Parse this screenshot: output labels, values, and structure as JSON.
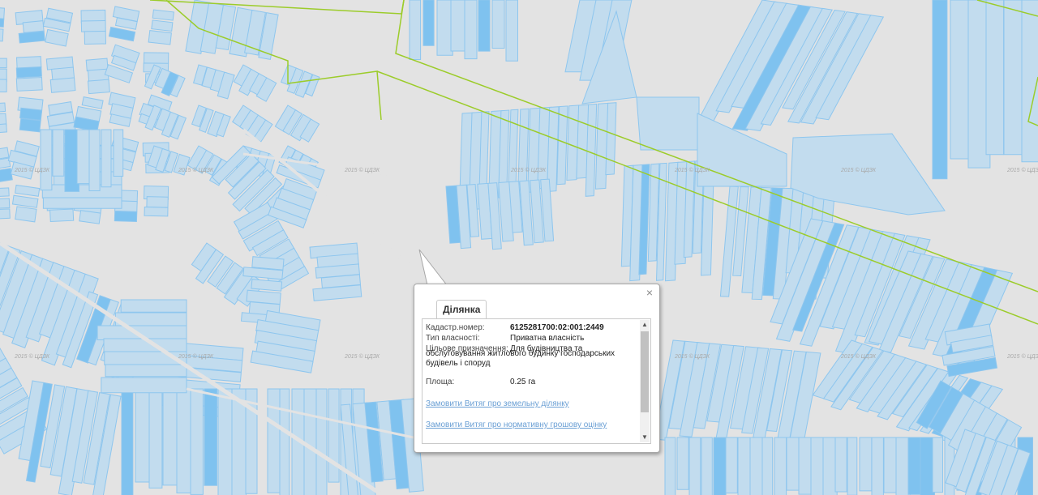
{
  "map": {
    "watermark_text": "2015 © ЦДЗК",
    "colors": {
      "background": "#e3e3e3",
      "parcel_fill": "#c2dcee",
      "parcel_stroke": "#8ec6ee",
      "boundary": "#9ccc2a",
      "highlight": "#7fc2ef"
    }
  },
  "popup": {
    "tab_label": "Ділянка",
    "close_glyph": "×",
    "fields": {
      "cadastral_label": "Кадастр.номер:",
      "cadastral_value": "6125281700:02:001:2449",
      "ownership_label": "Тип власності:",
      "ownership_value": "Приватна власність",
      "purpose_label": "Цільове призначення:",
      "purpose_value_line1": "Для будівництва та",
      "purpose_value_rest": "обслуговування житлового будинку господарських будівель і споруд",
      "area_label": "Площа:",
      "area_value": "0.25 га"
    },
    "links": {
      "land_extract": "Замовити Витяг про земельну ділянку",
      "valuation_extract": "Замовити Витяг про нормативну грошову оцінку"
    },
    "scrollbar": {
      "up_icon": "scroll-up-icon",
      "down_icon": "scroll-down-icon"
    }
  }
}
